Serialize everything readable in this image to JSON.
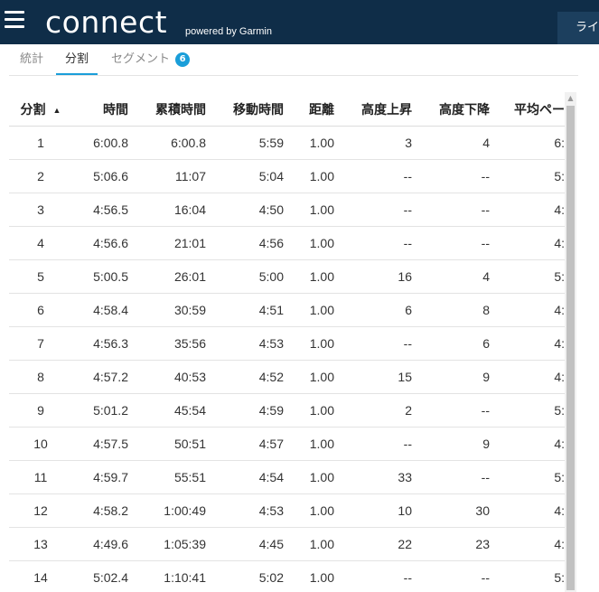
{
  "header": {
    "logo_text": "connect",
    "logo_sub": "powered by Garmin",
    "live_button": "ライブ"
  },
  "tabs": [
    {
      "label": "統計"
    },
    {
      "label": "分割"
    },
    {
      "label": "セグメント",
      "badge": "6"
    }
  ],
  "colors": {
    "topbar": "#0f2d48",
    "accent": "#1a9ed9"
  },
  "table": {
    "columns": [
      "分割",
      "時間",
      "累積時間",
      "移動時間",
      "距離",
      "高度上昇",
      "高度下降",
      "平均ペー"
    ],
    "sort_indicator": "▲",
    "rows": [
      [
        "1",
        "6:00.8",
        "6:00.8",
        "5:59",
        "1.00",
        "3",
        "4",
        "6:"
      ],
      [
        "2",
        "5:06.6",
        "11:07",
        "5:04",
        "1.00",
        "--",
        "--",
        "5:"
      ],
      [
        "3",
        "4:56.5",
        "16:04",
        "4:50",
        "1.00",
        "--",
        "--",
        "4:"
      ],
      [
        "4",
        "4:56.6",
        "21:01",
        "4:56",
        "1.00",
        "--",
        "--",
        "4:"
      ],
      [
        "5",
        "5:00.5",
        "26:01",
        "5:00",
        "1.00",
        "16",
        "4",
        "5:"
      ],
      [
        "6",
        "4:58.4",
        "30:59",
        "4:51",
        "1.00",
        "6",
        "8",
        "4:"
      ],
      [
        "7",
        "4:56.3",
        "35:56",
        "4:53",
        "1.00",
        "--",
        "6",
        "4:"
      ],
      [
        "8",
        "4:57.2",
        "40:53",
        "4:52",
        "1.00",
        "15",
        "9",
        "4:"
      ],
      [
        "9",
        "5:01.2",
        "45:54",
        "4:59",
        "1.00",
        "2",
        "--",
        "5:"
      ],
      [
        "10",
        "4:57.5",
        "50:51",
        "4:57",
        "1.00",
        "--",
        "9",
        "4:"
      ],
      [
        "11",
        "4:59.7",
        "55:51",
        "4:54",
        "1.00",
        "33",
        "--",
        "5:"
      ],
      [
        "12",
        "4:58.2",
        "1:00:49",
        "4:53",
        "1.00",
        "10",
        "30",
        "4:"
      ],
      [
        "13",
        "4:49.6",
        "1:05:39",
        "4:45",
        "1.00",
        "22",
        "23",
        "4:"
      ],
      [
        "14",
        "5:02.4",
        "1:10:41",
        "5:02",
        "1.00",
        "--",
        "--",
        "5:"
      ]
    ]
  }
}
